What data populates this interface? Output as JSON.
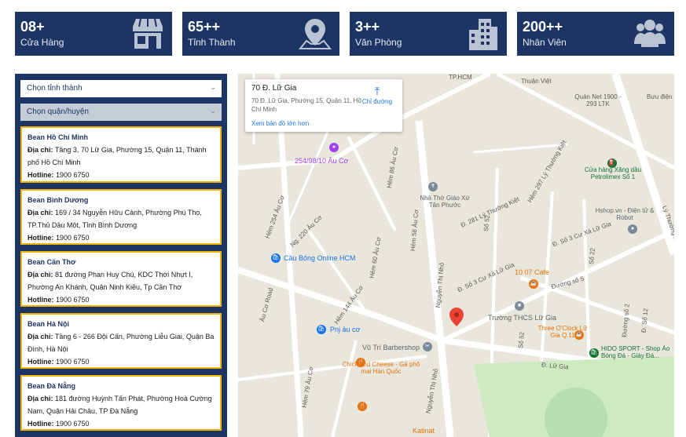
{
  "stats": [
    {
      "value": "08+",
      "label": "Cửa Hàng",
      "icon": "store-icon"
    },
    {
      "value": "65++",
      "label": "Tỉnh Thành",
      "icon": "map-pin-icon"
    },
    {
      "value": "3++",
      "label": "Văn Phòng",
      "icon": "building-icon"
    },
    {
      "value": "200++",
      "label": "Nhân Viên",
      "icon": "users-icon"
    }
  ],
  "filters": {
    "province_placeholder": "Chọn tỉnh thành",
    "district_placeholder": "Chọn quận/huyện"
  },
  "stores": [
    {
      "name": "Bean Hồ Chí Minh",
      "address_label": "Địa chỉ:",
      "address": "Tầng 3, 70 Lữ Gia, Phường 15, Quận 11, Thành phố Hồ Chí Minh",
      "hotline_label": "Hotline:",
      "hotline": "1900 6750"
    },
    {
      "name": "Bean Bình Dương",
      "address_label": "Địa chỉ:",
      "address": "169 / 34 Nguyễn Hữu Cảnh, Phường Phú Thọ, TP.Thủ Dầu Một, Tỉnh Bình Dương",
      "hotline_label": "Hotline:",
      "hotline": "1900 6750"
    },
    {
      "name": "Bean Cần Thơ",
      "address_label": "Địa chỉ:",
      "address": "81 đường Phan Huy Chú, KDC Thới Nhựt I, Phường An Khánh, Quận Ninh Kiều, Tp Cần Thơ",
      "hotline_label": "Hotline:",
      "hotline": "1900 6750"
    },
    {
      "name": "Bean Hà Nội",
      "address_label": "Địa chỉ:",
      "address": "Tầng 6 - 266 Đội Cấn, Phường Liễu Giai, Quận Ba Đình, Hà Nội",
      "hotline_label": "Hotline:",
      "hotline": "1900 6750"
    },
    {
      "name": "Bean Đà Nẵng",
      "address_label": "Địa chỉ:",
      "address": "181 đường Huỳnh Tấn Phát, Phường Hoà Cường Nam, Quận Hải Châu, TP Đà Nẵng",
      "hotline_label": "Hotline:",
      "hotline": "1900 6750"
    }
  ],
  "map": {
    "info_title": "70 Đ. Lữ Gia",
    "info_address": "70 Đ. Lữ Gia, Phường 15, Quận 11, Hồ Chí Minh",
    "directions_label": "Chỉ đường",
    "larger_map_label": "Xem bản đồ lớn hơn",
    "streets": [
      "Hẻm 254 Âu Cơ",
      "Ng. 220 Âu Cơ",
      "Hẻm 86 Âu Cơ",
      "Hẻm 60 Âu Cơ",
      "Hẻm 58 Âu Cơ",
      "Âu Cơ Road",
      "Hẻm 144 Âu Cơ",
      "Hẻm 79 Âu Cơ",
      "Nguyễn Thị Nhỏ",
      "Đ. 281 Lý Thường Kiệt",
      "Hẻm 297 Lý Thường Kiệt",
      "Lý Thường Kiệt",
      "Đ. Số 3 Cư Xá Lữ Gia",
      "Số 52",
      "Số 22",
      "Đường số 5",
      "Số 52",
      "Đ. Lữ Gia",
      "Đ. Số 12",
      "Đường số 2",
      "Đ. Số 3 Cư Xá Lữ Gia"
    ],
    "pois": [
      {
        "label": "254/98/10 Âu Cơ",
        "color": "#a142f4"
      },
      {
        "label": "Cầu Bông Online HCM",
        "color": "#1a73e8"
      },
      {
        "label": "Pnj âu cơ",
        "color": "#1a73e8"
      },
      {
        "label": "Nhà Thờ Giáo Xứ Tân Phước",
        "color": "#5f6368"
      },
      {
        "label": "Cửa hàng Xăng dầu Petrolimex Số 1",
        "color": "#137333"
      },
      {
        "label": "Hshop.vn - Điện tử & Robot",
        "color": "#5f6368"
      },
      {
        "label": "Quán Net 1900 - 293 LTK",
        "color": "#5f6368"
      },
      {
        "label": "Bưu điện",
        "color": "#5f6368"
      },
      {
        "label": "10 07 Cafe",
        "color": "#e8710a"
      },
      {
        "label": "Trường THCS Lữ Gia",
        "color": "#5f6368"
      },
      {
        "label": "Vũ Trí Barbershop",
        "color": "#5f6368"
      },
      {
        "label": "Chick and Cheese - Gà phô mai Hàn Quốc",
        "color": "#e8710a"
      },
      {
        "label": "Three O'Clock Lữ Gia Q.11",
        "color": "#e8710a"
      },
      {
        "label": "HIDO SPORT - Shop Áo Bóng Đá - Giày Đá...",
        "color": "#137333"
      },
      {
        "label": "Katinat",
        "color": "#e8710a"
      },
      {
        "label": "Thuận Việt",
        "color": "#5f6368"
      },
      {
        "label": "TP.HCM",
        "color": "#5f6368"
      }
    ]
  }
}
